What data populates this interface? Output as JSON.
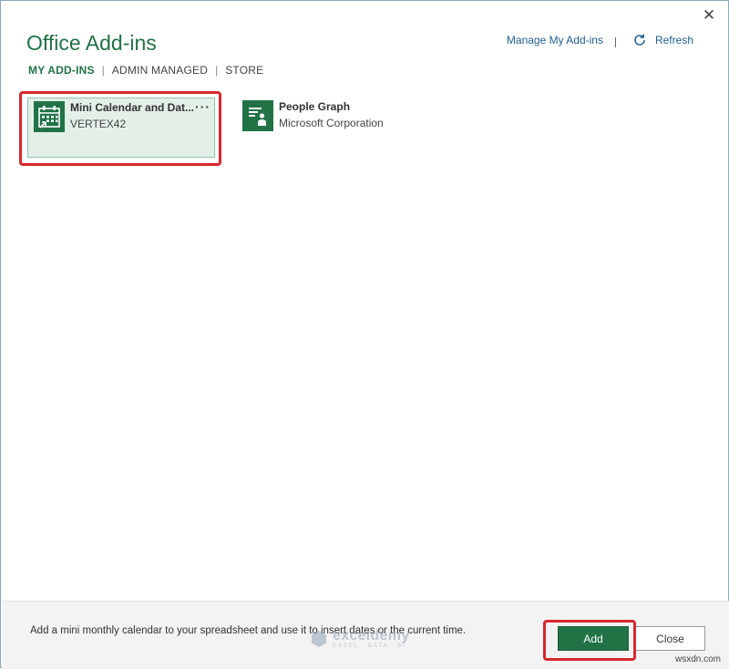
{
  "dialog": {
    "title": "Office Add-ins",
    "close_glyph": "✕"
  },
  "tabs": [
    {
      "label": "MY ADD-INS",
      "active": true
    },
    {
      "label": "ADMIN MANAGED",
      "active": false
    },
    {
      "label": "STORE",
      "active": false
    }
  ],
  "header_actions": {
    "manage_label": "Manage My Add-ins",
    "refresh_label": "Refresh",
    "refresh_icon": "refresh-icon"
  },
  "addins": [
    {
      "name": "Mini Calendar and Dat...",
      "publisher": "VERTEX42",
      "icon": "calendar-icon",
      "selected": true,
      "more": "···"
    },
    {
      "name": "People Graph",
      "publisher": "Microsoft Corporation",
      "icon": "people-graph-icon",
      "selected": false
    }
  ],
  "footer": {
    "description": "Add a mini monthly calendar to your spreadsheet and use it to insert dates or the current time.",
    "add_label": "Add",
    "close_label": "Close"
  },
  "watermark": {
    "name": "exceldemy",
    "sub": "EXCEL · DATA · BI"
  },
  "corner_text": "wsxdn.com",
  "colors": {
    "accent": "#217346",
    "link": "#1e5f8e",
    "highlight": "#d8272e",
    "selected_bg": "#e3f0e8"
  }
}
